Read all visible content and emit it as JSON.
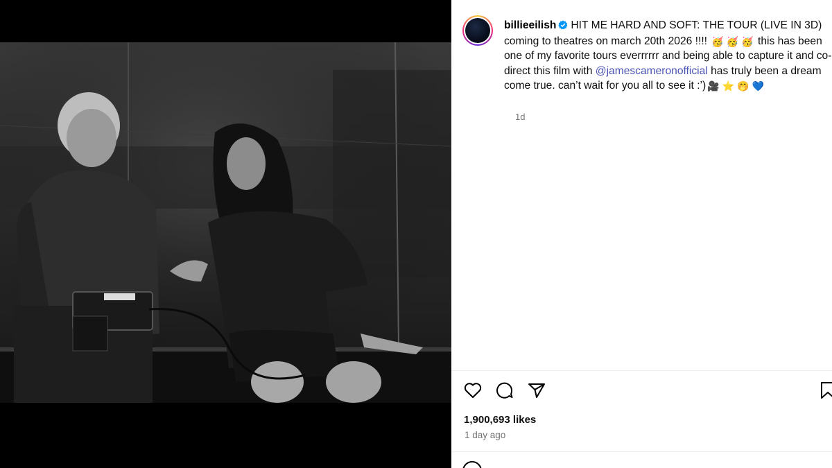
{
  "post": {
    "username": "billieeilish",
    "caption_pre": "HIT ME HARD AND SOFT: THE TOUR (LIVE IN 3D) coming to theatres on march 20th 2026 !!!!",
    "caption_mid": "this has been one of my favorite tours everrrrrr and being able to capture it and co-direct this film with",
    "mention": "@jamescameronofficial",
    "caption_post": "has truly been a dream come true. can’t wait for you all to see it :’)",
    "emoji_party_1": "🥳",
    "emoji_party_2": "🥳",
    "emoji_party_3": "🥳",
    "emoji_camera": "🎥",
    "emoji_star": "⭐",
    "emoji_face": "🤭",
    "emoji_heart": "💙",
    "time_short": "1d"
  },
  "stats": {
    "likes": "1,900,693 likes",
    "time_ago": "1 day ago"
  },
  "icons": {
    "like": "heart-icon",
    "comment": "comment-icon",
    "share": "paper-plane-icon",
    "save": "bookmark-icon",
    "verified": "verified-badge-icon"
  },
  "colors": {
    "mention": "#4a52b3",
    "verified": "#0095f6",
    "muted": "#737373"
  }
}
